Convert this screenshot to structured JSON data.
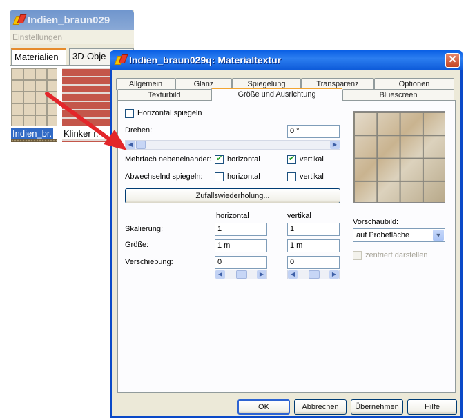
{
  "background_window": {
    "title": "Indien_braun029",
    "menu": "Einstellungen",
    "tabs": [
      "Materialien",
      "3D-Obje"
    ],
    "labels": [
      "Indien_br.",
      "Klinker r."
    ]
  },
  "dialog": {
    "title": "Indien_braun029q: Materialtextur",
    "tabs_row1": [
      "Allgemein",
      "Glanz",
      "Spiegelung",
      "Transparenz",
      "Optionen"
    ],
    "tabs_row2": [
      "Texturbild",
      "Größe und Ausrichtung",
      "Bluescreen"
    ],
    "active_tab": "Größe und Ausrichtung",
    "horizontal_spiegeln": {
      "label": "Horizontal spiegeln",
      "checked": false
    },
    "drehen": {
      "label": "Drehen:",
      "value": "0 °"
    },
    "mehrfach": {
      "label": "Mehrfach nebeneinander:",
      "horizontal": "horizontal",
      "vertikal": "vertikal",
      "horizontal_checked": true,
      "vertikal_checked": true
    },
    "abwechselnd": {
      "label": "Abwechselnd spiegeln:",
      "horizontal": "horizontal",
      "vertikal": "vertikal",
      "horizontal_checked": false,
      "vertikal_checked": false
    },
    "zufall_button": "Zufallswiederholung...",
    "grid": {
      "col_horizontal": "horizontal",
      "col_vertikal": "vertikal",
      "skalierung": {
        "label": "Skalierung:",
        "h": "1",
        "v": "1"
      },
      "groesse": {
        "label": "Größe:",
        "h": "1 m",
        "v": "1 m"
      },
      "verschiebung": {
        "label": "Verschiebung:",
        "h": "0",
        "v": "0"
      }
    },
    "vorschaubild": {
      "label": "Vorschaubild:",
      "value": "auf Probefläche"
    },
    "zentriert": {
      "label": "zentriert darstellen",
      "enabled": false
    },
    "buttons": {
      "ok": "OK",
      "cancel": "Abbrechen",
      "apply": "Übernehmen",
      "help": "Hilfe"
    }
  },
  "icons": [
    "app-icon",
    "close-icon",
    "chevron-down-icon",
    "scroll-left-icon",
    "scroll-right-icon",
    "annotation-arrow"
  ],
  "colors": {
    "titlebar": "#0a5fe4",
    "tab_highlight": "#f2a531",
    "arrow": "#e3262a"
  }
}
